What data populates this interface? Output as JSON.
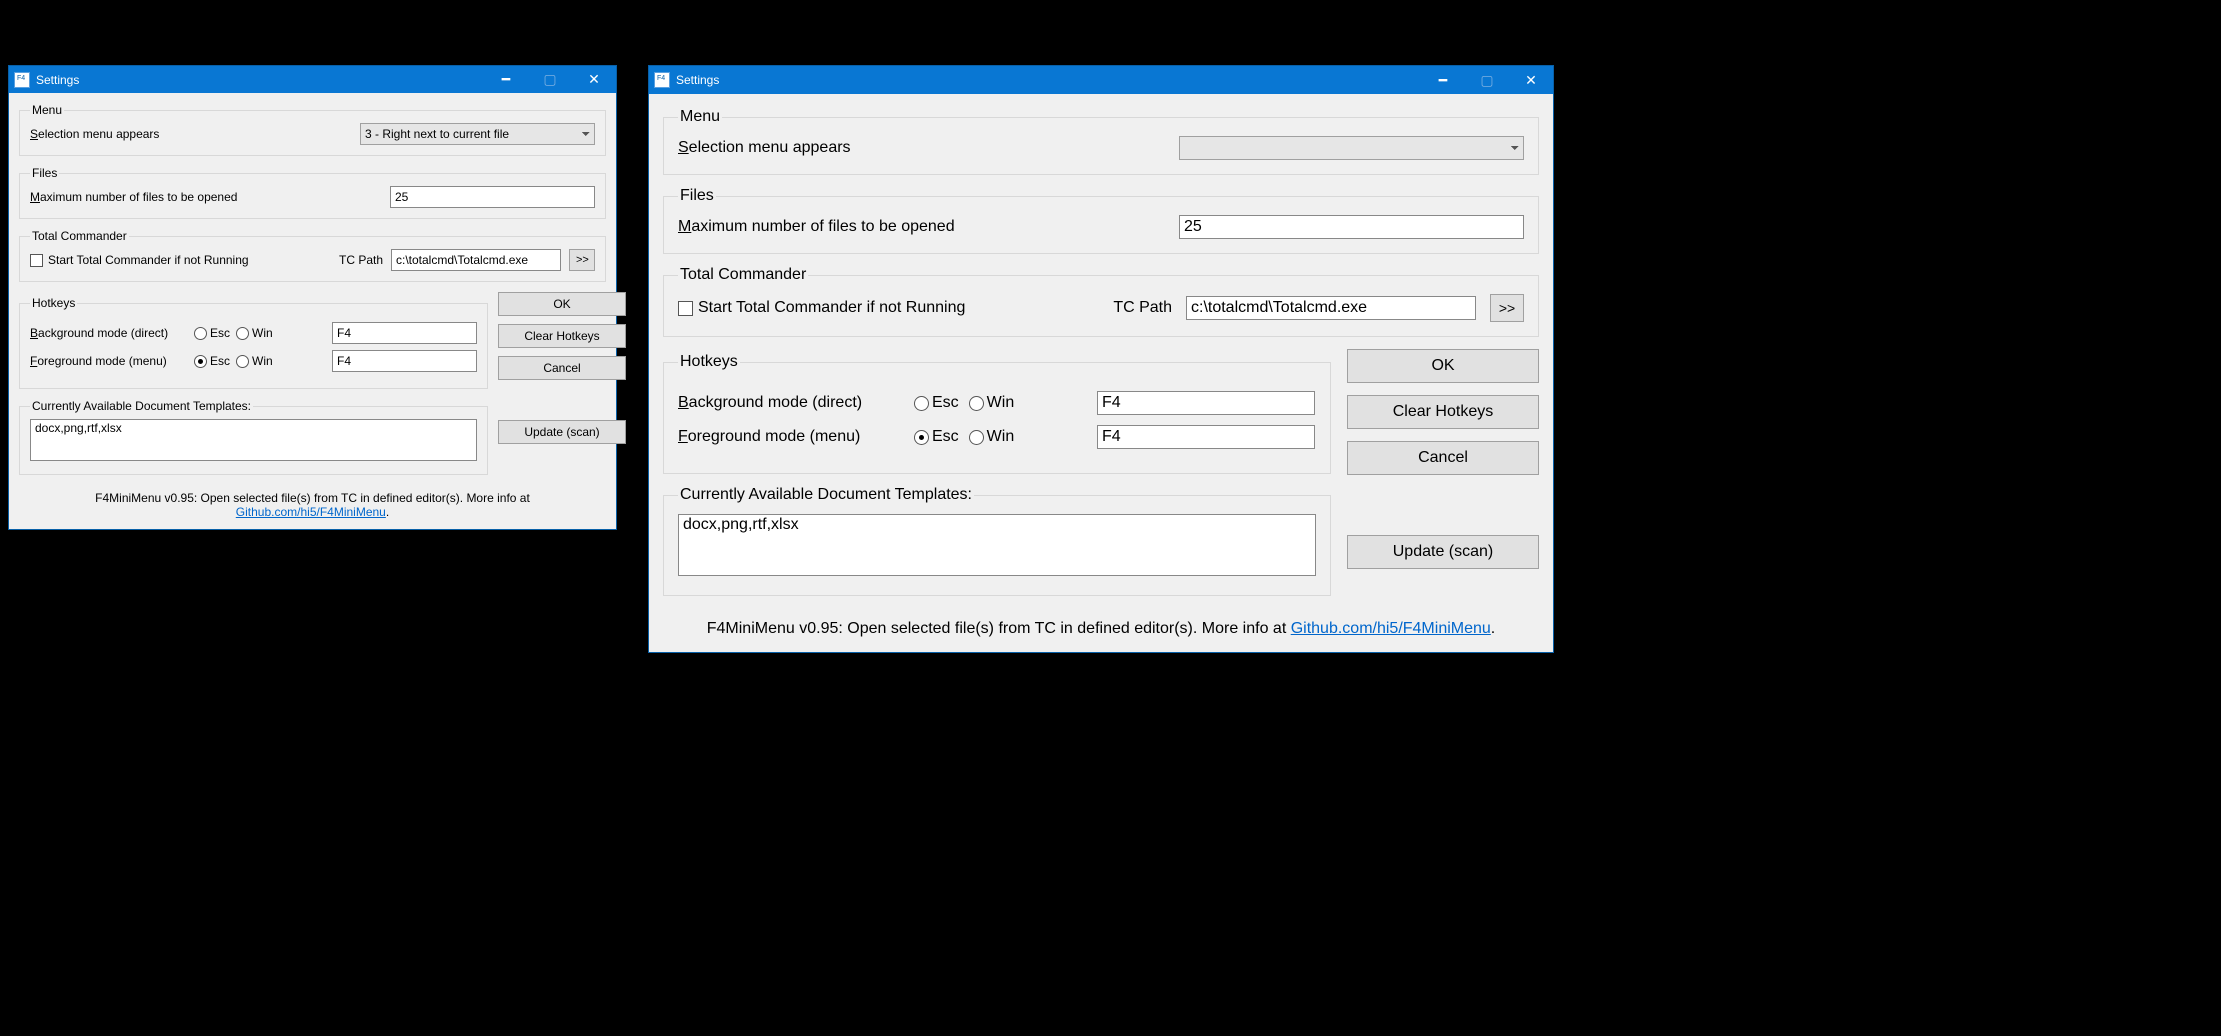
{
  "window_title": "Settings",
  "groups": {
    "menu": {
      "title": "Menu",
      "selection_label": "Selection menu appears",
      "selection_value": "3 - Right next to current file"
    },
    "files": {
      "title": "Files",
      "max_label": "Maximum number of files to be opened",
      "max_value": "25"
    },
    "tc": {
      "title": "Total Commander",
      "start_label": "Start Total Commander if not Running",
      "path_label": "TC Path",
      "path_value": "c:\\totalcmd\\Totalcmd.exe",
      "browse_label": ">>"
    },
    "hotkeys": {
      "title": "Hotkeys",
      "bg_label": "Background mode (direct)",
      "fg_label": "Foreground mode (menu)",
      "esc_label": "Esc",
      "win_label": "Win",
      "bg_value": "F4",
      "fg_value": "F4",
      "bg_selected": "none",
      "fg_selected": "esc"
    },
    "templates": {
      "title": "Currently Available Document Templates:",
      "value": "docx,png,rtf,xlsx"
    }
  },
  "buttons": {
    "ok": "OK",
    "clear": "Clear Hotkeys",
    "cancel": "Cancel",
    "update": "Update (scan)"
  },
  "footer": {
    "text_prefix": "F4MiniMenu v0.95: Open selected file(s) from TC in defined editor(s). More info at ",
    "link_text": "Github.com/hi5/F4MiniMenu",
    "suffix": "."
  },
  "win2_selection_empty": ""
}
